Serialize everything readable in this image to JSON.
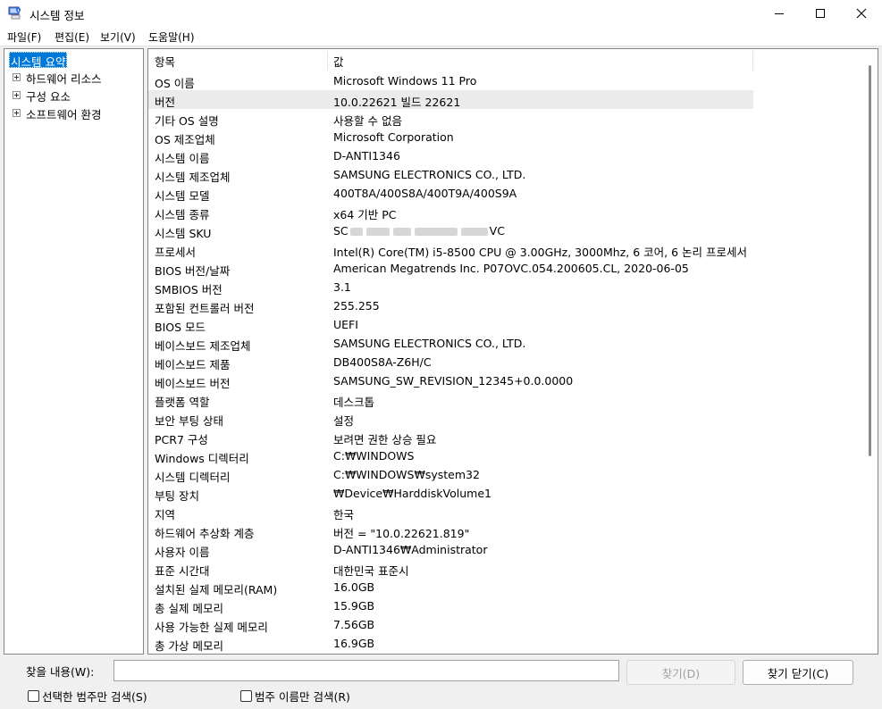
{
  "window": {
    "title": "시스템 정보"
  },
  "menu": [
    "파일(F)",
    "편집(E)",
    "보기(V)",
    "도움말(H)"
  ],
  "tree": {
    "selected": "시스템 요약",
    "items": [
      "하드웨어 리소스",
      "구성 요소",
      "소프트웨어 환경"
    ]
  },
  "table": {
    "headers": {
      "item": "항목",
      "value": "값"
    },
    "rows": [
      {
        "item": "OS 이름",
        "value": "Microsoft Windows 11 Pro"
      },
      {
        "item": "버전",
        "value": "10.0.22621 빌드 22621"
      },
      {
        "item": "기타 OS 설명",
        "value": "사용할 수 없음"
      },
      {
        "item": "OS 제조업체",
        "value": "Microsoft Corporation"
      },
      {
        "item": "시스템 이름",
        "value": "D-ANTI1346"
      },
      {
        "item": "시스템 제조업체",
        "value": "SAMSUNG ELECTRONICS CO., LTD."
      },
      {
        "item": "시스템 모델",
        "value": "400T8A/400S8A/400T9A/400S9A"
      },
      {
        "item": "시스템 종류",
        "value": "x64 기반 PC"
      },
      {
        "item": "시스템 SKU",
        "value_prefix": "SC",
        "value_suffix": "VC"
      },
      {
        "item": "프로세서",
        "value": "Intel(R) Core(TM) i5-8500 CPU @ 3.00GHz, 3000Mhz, 6 코어, 6 논리 프로세서"
      },
      {
        "item": "BIOS 버전/날짜",
        "value": "American Megatrends Inc. P07OVC.054.200605.CL, 2020-06-05"
      },
      {
        "item": "SMBIOS 버전",
        "value": "3.1"
      },
      {
        "item": "포함된 컨트롤러 버전",
        "value": "255.255"
      },
      {
        "item": "BIOS 모드",
        "value": "UEFI"
      },
      {
        "item": "베이스보드 제조업체",
        "value": "SAMSUNG ELECTRONICS CO., LTD."
      },
      {
        "item": "베이스보드 제품",
        "value": "DB400S8A-Z6H/C"
      },
      {
        "item": "베이스보드 버전",
        "value": "SAMSUNG_SW_REVISION_12345+0.0.0000"
      },
      {
        "item": "플랫폼 역할",
        "value": "데스크톱"
      },
      {
        "item": "보안 부팅 상태",
        "value": "설정"
      },
      {
        "item": "PCR7 구성",
        "value": "보려면 권한 상승 필요"
      },
      {
        "item": "Windows 디렉터리",
        "value": "C:₩WINDOWS"
      },
      {
        "item": "시스템 디렉터리",
        "value": "C:₩WINDOWS₩system32"
      },
      {
        "item": "부팅 장치",
        "value": "₩Device₩HarddiskVolume1"
      },
      {
        "item": "지역",
        "value": "한국"
      },
      {
        "item": "하드웨어 추상화 계층",
        "value": "버전 = \"10.0.22621.819\""
      },
      {
        "item": "사용자 이름",
        "value": "D-ANTI1346₩Administrator"
      },
      {
        "item": "표준 시간대",
        "value": "대한민국 표준시"
      },
      {
        "item": "설치된 실제 메모리(RAM)",
        "value": "16.0GB"
      },
      {
        "item": "총 실제 메모리",
        "value": "15.9GB"
      },
      {
        "item": "사용 가능한 실제 메모리",
        "value": "7.56GB"
      },
      {
        "item": "총 가상 메모리",
        "value": "16.9GB"
      }
    ]
  },
  "find": {
    "label": "찾을 내용(W):",
    "value": "",
    "find_button": "찾기(D)",
    "close_button": "찾기 닫기(C)",
    "option_selected_category": "선택한 범주만 검색(S)",
    "option_category_names": "범주 이름만 검색(R)"
  },
  "colors": {
    "selection": "#0078d7",
    "highlight_row": "#ebebeb"
  },
  "icons": {
    "app": "system-info-icon",
    "minimize": "minimize-icon",
    "maximize": "maximize-icon",
    "close": "close-icon"
  }
}
